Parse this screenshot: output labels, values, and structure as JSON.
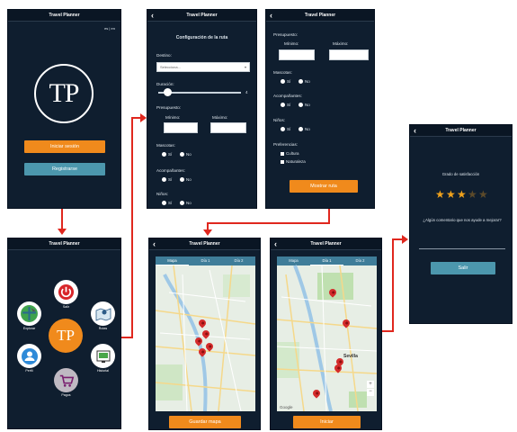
{
  "app_title": "Travel Planner",
  "screen1": {
    "lang": "es | en",
    "logo": "TP",
    "login_button": "Iniciar sesión",
    "register_button": "Registrarse"
  },
  "screen2": {
    "heading": "Configuración de la ruta",
    "destino_label": "Destino:",
    "destino_placeholder": "Selecciona...",
    "duracion_label": "Duración:",
    "duracion_value": "4",
    "presupuesto_label": "Presupuesto:",
    "minimo_label": "Mínimo:",
    "maximo_label": "Máximo:",
    "mascotas_label": "Mascotas:",
    "acompanantes_label": "Acompañantes:",
    "ninos_label": "Niños:",
    "si": "Sí",
    "no": "No"
  },
  "screen3": {
    "presupuesto_label": "Presupuesto:",
    "minimo_label": "Mínimo:",
    "maximo_label": "Máximo:",
    "mascotas_label": "Mascotas:",
    "acompanantes_label": "Acompañantes:",
    "ninos_label": "Niños:",
    "preferencias_label": "Preferencias:",
    "pref_1": "Cultura",
    "pref_2": "Naturaleza",
    "show_route_button": "Mostrar ruta",
    "si": "Sí",
    "no": "No"
  },
  "screen4": {
    "logo": "TP",
    "menu_labels": [
      "Salir",
      "Explorar",
      "Rutas",
      "Perfil",
      "Pagos",
      "Historial"
    ]
  },
  "screen5": {
    "tabs": [
      "Mapa",
      "Día 1",
      "Día 2"
    ],
    "save_button": "Guardar mapa"
  },
  "screen6": {
    "tabs": [
      "Mapa",
      "Día 1",
      "Día 2"
    ],
    "start_button": "Iniciar",
    "city_label": "Sevilla",
    "map_credit": "Google"
  },
  "screen7": {
    "heading": "Grado de satisfacción",
    "rating": 3,
    "max_rating": 5,
    "question": "¿Algún comentario que nos ayude a mejorar?",
    "exit_button": "Salir"
  },
  "colors": {
    "background": "#0f1e2f",
    "accent": "#f08a1c",
    "secondary": "#4c97ad",
    "arrow": "#e0271e",
    "pin": "#d42b2b"
  }
}
